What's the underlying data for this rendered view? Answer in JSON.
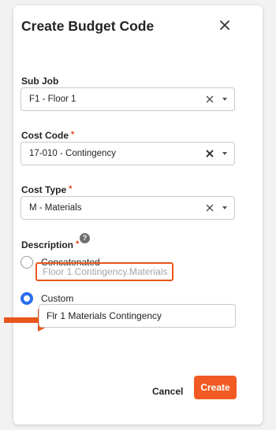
{
  "dialog": {
    "title": "Create Budget Code",
    "close_icon": "close-icon"
  },
  "sub_job": {
    "label": "Sub Job",
    "value": "F1 - Floor 1",
    "required": false
  },
  "cost_code": {
    "label": "Cost Code",
    "required_marker": "*",
    "value": "17-010 - Contingency"
  },
  "cost_type": {
    "label": "Cost Type",
    "required_marker": "*",
    "value": "M - Materials"
  },
  "description": {
    "label": "Description",
    "required_marker": "*",
    "help_icon": "question-circle-icon",
    "help_glyph": "?",
    "options": [
      {
        "label": "Concatenated",
        "selected": false,
        "preview": "Floor 1.Contingency.Materials"
      },
      {
        "label": "Custom",
        "selected": true,
        "value": "Flr 1 Materials Contingency"
      }
    ]
  },
  "footer": {
    "cancel_label": "Cancel",
    "create_label": "Create"
  },
  "colors": {
    "accent_orange": "#f15a22",
    "highlight_orange": "#e8561b",
    "radio_blue": "#2a6df0",
    "required_red": "#e6491a"
  }
}
